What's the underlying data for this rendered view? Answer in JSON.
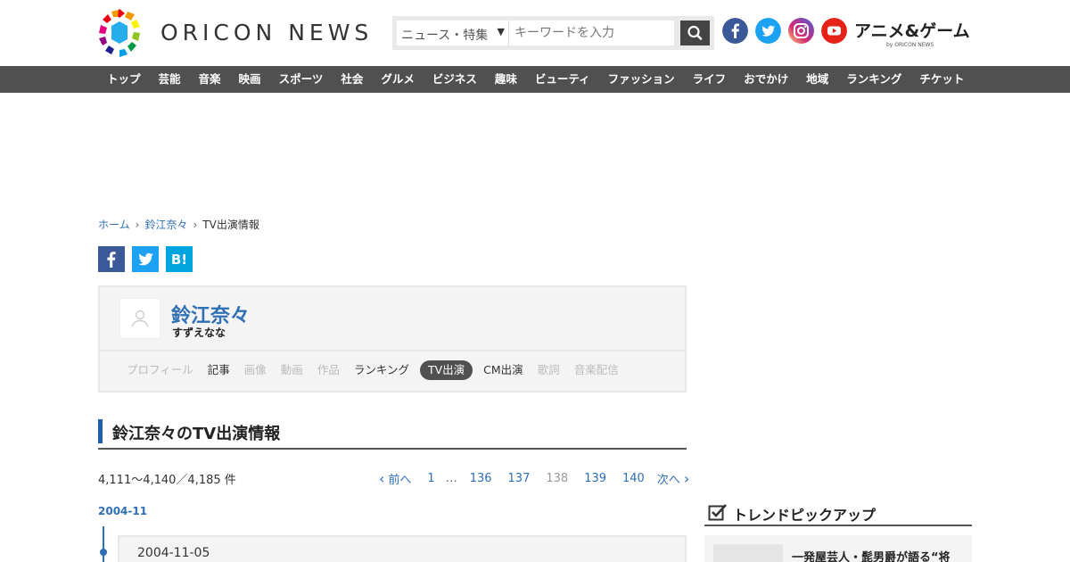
{
  "header": {
    "logo_text": "ORICON NEWS",
    "search": {
      "category": "ニュース・特集",
      "placeholder": "キーワードを入力"
    },
    "sns": [
      "facebook-icon",
      "twitter-icon",
      "instagram-icon",
      "youtube-icon"
    ],
    "anime_logo": "アニメ&ゲーム",
    "anime_logo_sub": "by ORICON NEWS"
  },
  "nav": {
    "items": [
      "トップ",
      "芸能",
      "音楽",
      "映画",
      "スポーツ",
      "社会",
      "グルメ",
      "ビジネス",
      "趣味",
      "ビューティ",
      "ファッション",
      "ライフ",
      "おでかけ",
      "地域",
      "ランキング",
      "チケット"
    ]
  },
  "breadcrumb": {
    "home": "ホーム",
    "artist": "鈴江奈々",
    "current": "TV出演情報"
  },
  "share": {
    "hatena": "B!"
  },
  "profile": {
    "name": "鈴江奈々",
    "kana": "すずえなな",
    "tabs": [
      {
        "label": "プロフィール",
        "state": "disabled"
      },
      {
        "label": "記事",
        "state": "enabled"
      },
      {
        "label": "画像",
        "state": "disabled"
      },
      {
        "label": "動画",
        "state": "disabled"
      },
      {
        "label": "作品",
        "state": "disabled"
      },
      {
        "label": "ランキング",
        "state": "enabled"
      },
      {
        "label": "TV出演",
        "state": "active"
      },
      {
        "label": "CM出演",
        "state": "enabled"
      },
      {
        "label": "歌詞",
        "state": "disabled"
      },
      {
        "label": "音楽配信",
        "state": "disabled"
      }
    ]
  },
  "section": {
    "title": "鈴江奈々のTV出演情報"
  },
  "listing": {
    "count": "4,111～4,140／4,185 件",
    "pager": {
      "prev": "前へ",
      "first": "1",
      "dots": "…",
      "pages": [
        "136",
        "137",
        "138",
        "139",
        "140"
      ],
      "current": "138",
      "next": "次へ"
    }
  },
  "timeline": {
    "month": "2004-11",
    "entries": [
      {
        "date": "2004-11-05"
      }
    ]
  },
  "sidebar": {
    "title": "トレンドピックアップ",
    "items": [
      {
        "title": "一発屋芸人・髭男爵が語る“将"
      }
    ]
  },
  "colors": {
    "link": "#2f6fb3",
    "nav_bg": "#505050",
    "accent_bar": "#1d5fa8"
  }
}
